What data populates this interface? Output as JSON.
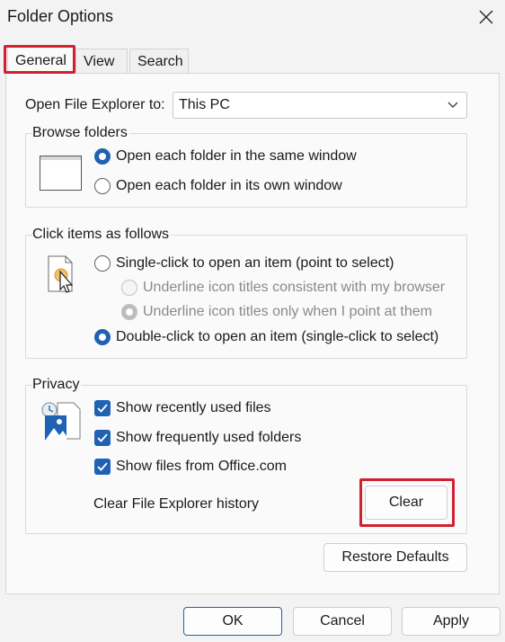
{
  "window": {
    "title": "Folder Options"
  },
  "tabs": [
    {
      "label": "General",
      "active": true
    },
    {
      "label": "View",
      "active": false
    },
    {
      "label": "Search",
      "active": false
    }
  ],
  "open_explorer": {
    "label": "Open File Explorer to:",
    "value": "This PC"
  },
  "browse_folders": {
    "title": "Browse folders",
    "options": [
      {
        "label": "Open each folder in the same window",
        "selected": true
      },
      {
        "label": "Open each folder in its own window",
        "selected": false
      }
    ]
  },
  "click_items": {
    "title": "Click items as follows",
    "single_click": "Single-click to open an item (point to select)",
    "underline_browser": "Underline icon titles consistent with my browser",
    "underline_point": "Underline icon titles only when I point at them",
    "double_click": "Double-click to open an item (single-click to select)"
  },
  "privacy": {
    "title": "Privacy",
    "show_recent_files": "Show recently used files",
    "show_frequent_folders": "Show frequently used folders",
    "show_office_files": "Show files from Office.com",
    "clear_history_label": "Clear File Explorer history",
    "clear_button": "Clear"
  },
  "buttons": {
    "restore_defaults": "Restore Defaults",
    "ok": "OK",
    "cancel": "Cancel",
    "apply": "Apply"
  },
  "colors": {
    "accent": "#1f62b4",
    "highlight": "#d32030"
  }
}
